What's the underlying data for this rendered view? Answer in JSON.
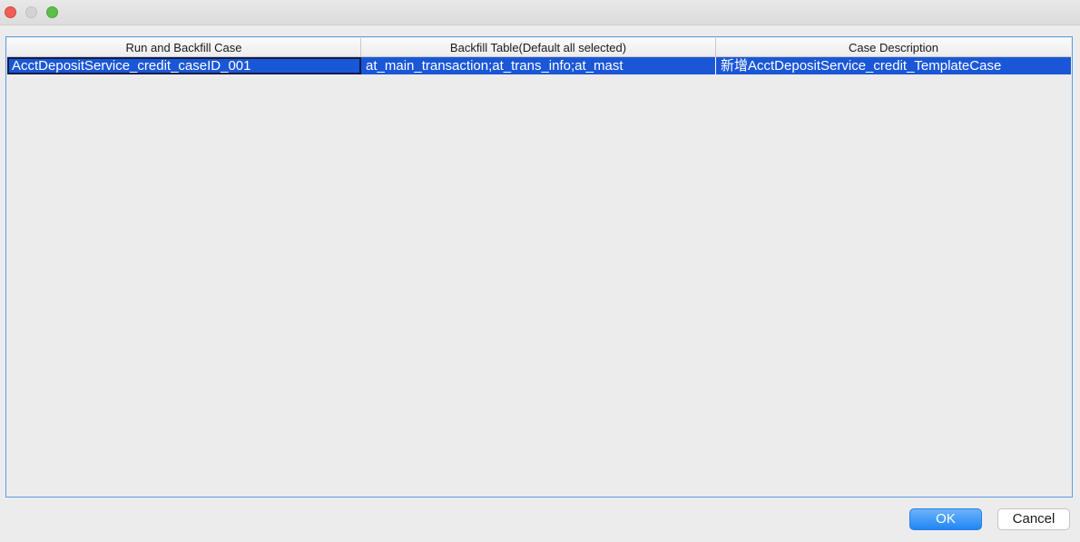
{
  "window": {
    "controls": [
      "close",
      "minimize",
      "zoom"
    ]
  },
  "table": {
    "columns": [
      "Run and Backfill Case",
      "Backfill Table(Default all selected)",
      "Case Description"
    ],
    "rows": [
      {
        "case": "AcctDepositService_credit_caseID_001",
        "tables": "at_main_transaction;at_trans_info;at_mast",
        "description": "新增AcctDepositService_credit_TemplateCase",
        "selected": true
      }
    ]
  },
  "buttons": {
    "ok_label": "OK",
    "cancel_label": "Cancel"
  },
  "colors": {
    "selection": "#1a57d6",
    "focus_border": "#5b9ce8",
    "ok_button": "#1f87f5"
  }
}
